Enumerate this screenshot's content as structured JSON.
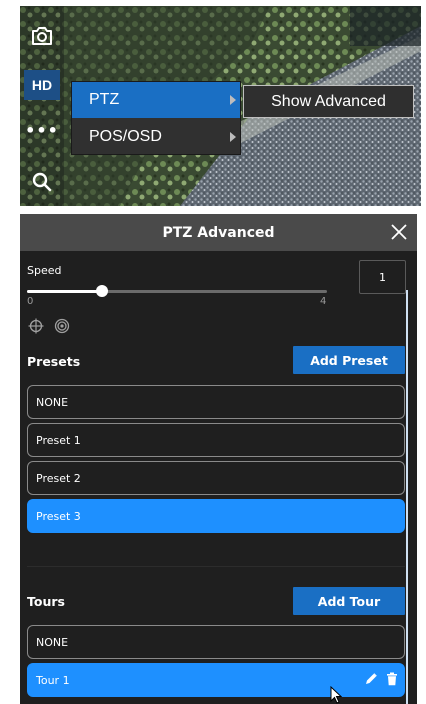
{
  "camera_toolbar": {
    "hd_label": "HD",
    "more_label": "•••"
  },
  "context_menu": {
    "items": [
      {
        "label": "PTZ",
        "active": true
      },
      {
        "label": "POS/OSD",
        "active": false
      }
    ],
    "submenu_label": "Show Advanced"
  },
  "panel": {
    "title": "PTZ Advanced",
    "speed": {
      "label": "Speed",
      "min_label": "0",
      "max_label": "4",
      "min": 0,
      "max": 4,
      "value": 1,
      "value_label": "1"
    },
    "presets": {
      "title": "Presets",
      "add_label": "Add Preset",
      "items": [
        {
          "label": "NONE",
          "selected": false
        },
        {
          "label": "Preset 1",
          "selected": false
        },
        {
          "label": "Preset 2",
          "selected": false
        },
        {
          "label": "Preset 3",
          "selected": true
        }
      ]
    },
    "tours": {
      "title": "Tours",
      "add_label": "Add Tour",
      "items": [
        {
          "label": "NONE",
          "selected": false
        },
        {
          "label": "Tour 1",
          "selected": true
        }
      ]
    }
  },
  "colors": {
    "accent": "#1a6fc4",
    "selected_row": "#1e90ff",
    "panel_bg": "#1f1f1f",
    "header_bg": "#4a4a4a"
  }
}
